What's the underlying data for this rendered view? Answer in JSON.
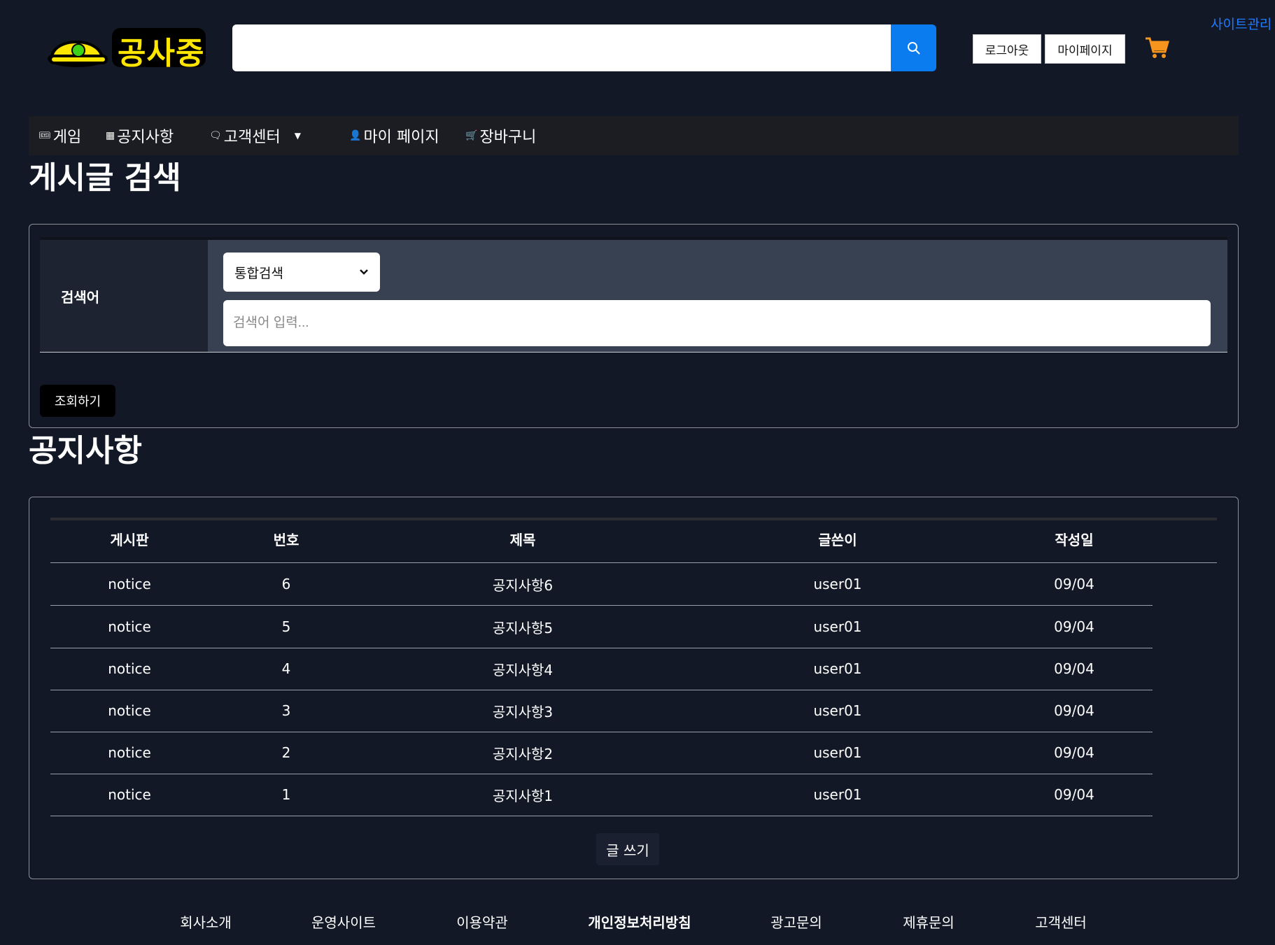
{
  "header": {
    "logo_text": "공사중",
    "search_value": "",
    "logout_label": "로그아웃",
    "mypage_label": "마이페이지",
    "admin_label": "사이트관리"
  },
  "nav": {
    "items": [
      {
        "icon": "🎟",
        "label": "게임"
      },
      {
        "icon": "▦",
        "label": "공지사항"
      },
      {
        "icon": "🗨",
        "label": "고객센터"
      },
      {
        "icon": "👤",
        "label": "마이 페이지"
      },
      {
        "icon": "🛒",
        "label": "장바구니"
      }
    ]
  },
  "search_section": {
    "title": "게시글 검색",
    "label": "검색어",
    "select_value": "통합검색",
    "input_placeholder": "검색어 입력...",
    "submit_label": "조회하기"
  },
  "board": {
    "title": "공지사항",
    "columns": [
      "게시판",
      "번호",
      "제목",
      "글쓴이",
      "작성일"
    ],
    "rows": [
      [
        "notice",
        "6",
        "공지사항6",
        "user01",
        "09/04"
      ],
      [
        "notice",
        "5",
        "공지사항5",
        "user01",
        "09/04"
      ],
      [
        "notice",
        "4",
        "공지사항4",
        "user01",
        "09/04"
      ],
      [
        "notice",
        "3",
        "공지사항3",
        "user01",
        "09/04"
      ],
      [
        "notice",
        "2",
        "공지사항2",
        "user01",
        "09/04"
      ],
      [
        "notice",
        "1",
        "공지사항1",
        "user01",
        "09/04"
      ]
    ],
    "write_label": "글 쓰기"
  },
  "footer": {
    "links": [
      "회사소개",
      "운영사이트",
      "이용약관",
      "개인정보처리방침",
      "광고문의",
      "제휴문의",
      "고객센터"
    ]
  },
  "colors": {
    "background": "#121826",
    "search_button": "#0a7cf0",
    "cart": "#f7941d",
    "admin_link": "#1f7bff",
    "logo_text": "#ffe600",
    "logo_helmet": "#ffe600"
  }
}
